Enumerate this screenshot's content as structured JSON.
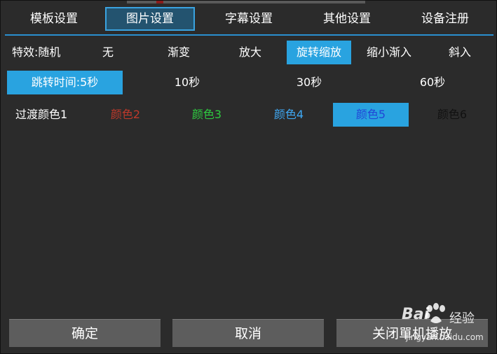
{
  "tabs": [
    {
      "label": "模板设置"
    },
    {
      "label": "图片设置"
    },
    {
      "label": "字幕设置"
    },
    {
      "label": "其他设置"
    },
    {
      "label": "设备注册"
    }
  ],
  "active_tab": 1,
  "effects": {
    "label": "特效:随机",
    "options": [
      "无",
      "渐变",
      "放大",
      "旋转缩放",
      "缩小渐入",
      "斜入"
    ],
    "selected": "旋转缩放"
  },
  "jump_time": {
    "selected_label": "跳转时间:5秒",
    "options": [
      "10秒",
      "30秒",
      "60秒"
    ]
  },
  "transition_color": {
    "label": "过渡颜色1",
    "options": [
      {
        "label": "颜色2",
        "color": "#c0392b"
      },
      {
        "label": "颜色3",
        "color": "#2ecc40"
      },
      {
        "label": "颜色4",
        "color": "#3fa9f5"
      },
      {
        "label": "颜色5",
        "color": "#2145d6"
      },
      {
        "label": "颜色6",
        "color": "#111111"
      }
    ],
    "selected": "颜色5"
  },
  "footer": {
    "confirm": "确定",
    "cancel": "取消",
    "close": "关闭單机播放"
  },
  "watermark": {
    "logo": "Bai",
    "logo_suffix": "经验",
    "url": "jingyan.baidu.com"
  },
  "colors": {
    "accent": "#29a3e0",
    "background": "#2b2b2b",
    "button": "#5d5d5d"
  }
}
